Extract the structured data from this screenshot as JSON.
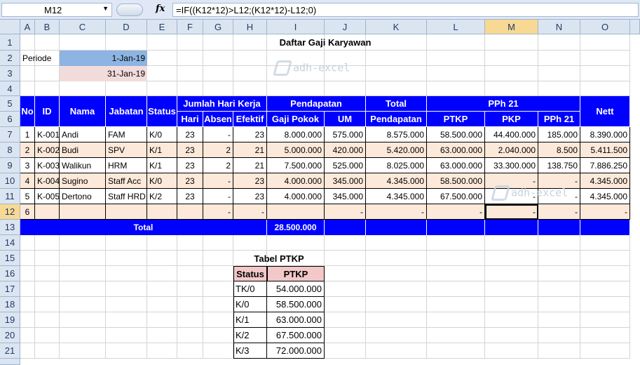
{
  "formula_bar": {
    "name_box": "M12",
    "fx": "fx",
    "formula": "=IF((K12*12)>L12;(K12*12)-L12;0)"
  },
  "columns": [
    "A",
    "B",
    "C",
    "D",
    "E",
    "F",
    "G",
    "H",
    "I",
    "J",
    "K",
    "L",
    "M",
    "N",
    "O"
  ],
  "rows": [
    "1",
    "2",
    "3",
    "4",
    "5",
    "6",
    "7",
    "8",
    "9",
    "10",
    "11",
    "12",
    "13",
    "14",
    "15",
    "16",
    "17",
    "18",
    "19",
    "20",
    "21"
  ],
  "selected_column": "M",
  "selected_row": "12",
  "title": "Daftar Gaji Karyawan",
  "periode_label": "Periode",
  "periode_start": "1-Jan-19",
  "periode_end": "31-Jan-19",
  "watermark": "adh-excel",
  "headers": {
    "no": "No",
    "id": "ID",
    "nama": "Nama",
    "jabatan": "Jabatan",
    "status": "Status",
    "jumlah_hari_kerja": "Jumlah Hari Kerja",
    "hari": "Hari",
    "absen": "Absen",
    "efektif": "Efektif",
    "pendapatan": "Pendapatan",
    "gaji_pokok": "Gaji Pokok",
    "um": "UM",
    "total": "Total",
    "total_pendapatan": "Pendapatan",
    "pph21_group": "PPh 21",
    "ptkp": "PTKP",
    "pkp": "PKP",
    "pph21": "PPh 21",
    "nett": "Nett"
  },
  "employees": [
    {
      "no": "1",
      "id": "K-001",
      "nama": "Andi",
      "jabatan": "FAM",
      "status": "K/0",
      "hari": "23",
      "absen": "-",
      "efektif": "23",
      "gaji_pokok": "8.000.000",
      "um": "575.000",
      "total": "8.575.000",
      "ptkp": "58.500.000",
      "pkp": "44.400.000",
      "pph21": "185.000",
      "nett": "8.390.000"
    },
    {
      "no": "2",
      "id": "K-002",
      "nama": "Budi",
      "jabatan": "SPV",
      "status": "K/1",
      "hari": "23",
      "absen": "2",
      "efektif": "21",
      "gaji_pokok": "5.000.000",
      "um": "420.000",
      "total": "5.420.000",
      "ptkp": "63.000.000",
      "pkp": "2.040.000",
      "pph21": "8.500",
      "nett": "5.411.500"
    },
    {
      "no": "3",
      "id": "K-003",
      "nama": "Walikun",
      "jabatan": "HRM",
      "status": "K/1",
      "hari": "23",
      "absen": "2",
      "efektif": "21",
      "gaji_pokok": "7.500.000",
      "um": "525.000",
      "total": "8.025.000",
      "ptkp": "63.000.000",
      "pkp": "33.300.000",
      "pph21": "138.750",
      "nett": "7.886.250"
    },
    {
      "no": "4",
      "id": "K-004",
      "nama": "Sugino",
      "jabatan": "Staff Acc",
      "status": "K/0",
      "hari": "23",
      "absen": "-",
      "efektif": "23",
      "gaji_pokok": "4.000.000",
      "um": "345.000",
      "total": "4.345.000",
      "ptkp": "58.500.000",
      "pkp": "-",
      "pph21": "-",
      "nett": "4.345.000"
    },
    {
      "no": "5",
      "id": "K-005",
      "nama": "Dertono",
      "jabatan": "Staff HRD",
      "status": "K/2",
      "hari": "23",
      "absen": "-",
      "efektif": "23",
      "gaji_pokok": "4.000.000",
      "um": "345.000",
      "total": "4.345.000",
      "ptkp": "67.500.000",
      "pkp": "-",
      "pph21": "-",
      "nett": "4.345.000"
    },
    {
      "no": "6",
      "id": "",
      "nama": "",
      "jabatan": "",
      "status": "",
      "hari": "",
      "absen": "-",
      "efektif": "-",
      "gaji_pokok": "",
      "um": "-",
      "total": "-",
      "ptkp": "-",
      "pkp": "-",
      "pph21": "-",
      "nett": "-"
    }
  ],
  "total_label": "Total",
  "total_gaji_pokok": "28.500.000",
  "ptkp_table": {
    "title": "Tabel PTKP",
    "col_status": "Status",
    "col_ptkp": "PTKP",
    "rows": [
      {
        "status": "TK/0",
        "ptkp": "54.000.000"
      },
      {
        "status": "K/0",
        "ptkp": "58.500.000"
      },
      {
        "status": "K/1",
        "ptkp": "63.000.000"
      },
      {
        "status": "K/2",
        "ptkp": "67.500.000"
      },
      {
        "status": "K/3",
        "ptkp": "72.000.000"
      }
    ]
  }
}
